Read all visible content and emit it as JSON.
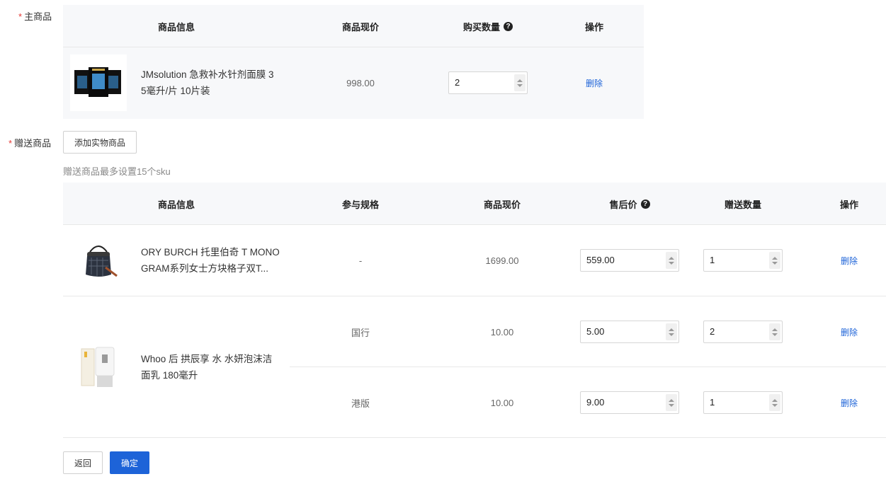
{
  "main_section": {
    "label": "主商品",
    "headers": {
      "info": "商品信息",
      "price": "商品现价",
      "qty": "购买数量",
      "action": "操作"
    },
    "help_glyph": "?",
    "item": {
      "name_line1": "JMsolution 急救补水针剂面膜 3",
      "name_line2": "5毫升/片 10片装",
      "price": "998.00",
      "qty": "2",
      "delete": "删除"
    }
  },
  "gift_section": {
    "label": "赠送商品",
    "add_button": "添加实物商品",
    "hint": "赠送商品最多设置15个sku",
    "headers": {
      "info": "商品信息",
      "spec": "参与规格",
      "price": "商品现价",
      "after_price": "售后价",
      "qty": "赠送数量",
      "action": "操作"
    },
    "help_glyph": "?",
    "items": [
      {
        "name_line1": "ORY BURCH 托里伯奇 T MONO",
        "name_line2": "GRAM系列女士方块格子双T...",
        "spec": "-",
        "price": "1699.00",
        "after_price": "559.00",
        "qty": "1",
        "delete": "删除"
      },
      {
        "name_line1": "Whoo 后 拱辰享 水 水妍泡沫洁",
        "name_line2": "面乳 180毫升",
        "skus": [
          {
            "spec": "国行",
            "price": "10.00",
            "after_price": "5.00",
            "qty": "2",
            "delete": "删除"
          },
          {
            "spec": "港版",
            "price": "10.00",
            "after_price": "9.00",
            "qty": "1",
            "delete": "删除"
          }
        ]
      }
    ]
  },
  "footer": {
    "back": "返回",
    "confirm": "确定"
  },
  "colors": {
    "primary": "#1d63d8",
    "required": "#e53935",
    "header_bg": "#f7f8fa"
  }
}
